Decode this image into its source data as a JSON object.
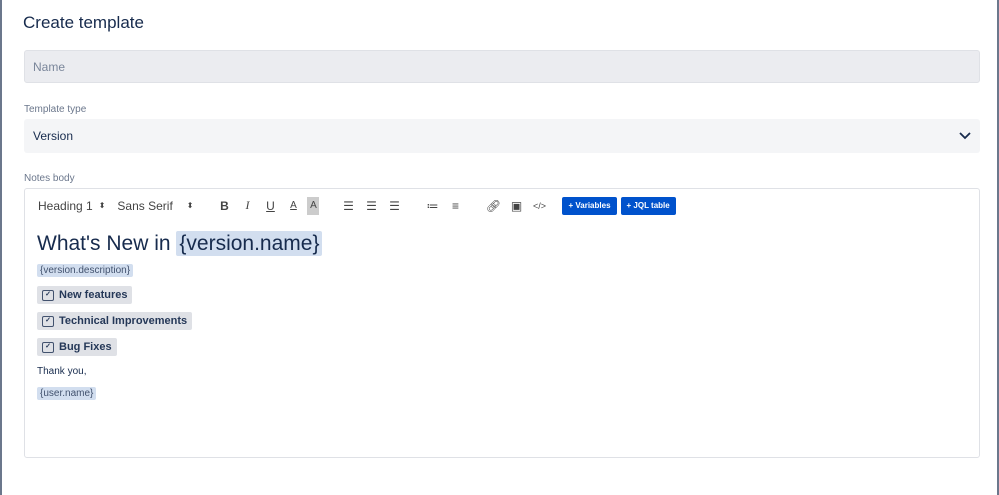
{
  "title": "Create template",
  "name_field": {
    "placeholder": "Name",
    "value": ""
  },
  "template_type": {
    "label": "Template type",
    "selected": "Version"
  },
  "notes_body": {
    "label": "Notes body",
    "toolbar": {
      "heading": "Heading 1",
      "font": "Sans Serif",
      "variables_button": "+ Variables",
      "jql_button": "+ JQL table"
    },
    "content": {
      "heading_prefix": "What's New in ",
      "heading_var": "{version.name}",
      "description_var": "{version.description}",
      "sections": [
        "New features",
        "Technical Improvements",
        "Bug Fixes"
      ],
      "closing": "Thank you,",
      "user_var": "{user.name}"
    }
  }
}
